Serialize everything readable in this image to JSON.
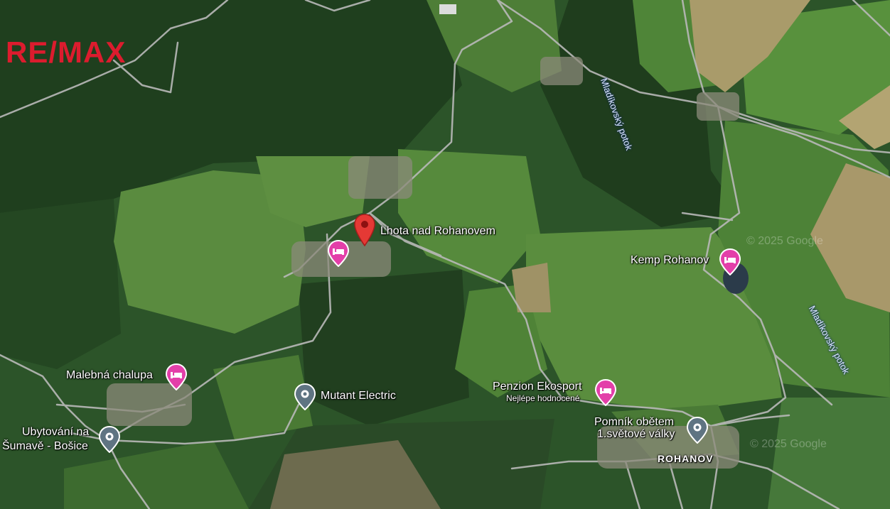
{
  "logo": {
    "text": "RE/MAX"
  },
  "map": {
    "copyright_top": "© 2025 Google",
    "copyright_bottom": "© 2025 Google"
  },
  "places": {
    "main_marker": {
      "label": "Lhota nad Rohanovem",
      "icon": "red-location-pin-icon"
    },
    "kemp": {
      "label": "Kemp Rohanov",
      "icon": "hotel-bed-icon"
    },
    "malebna": {
      "label": "Malebná chalupa",
      "icon": "hotel-bed-icon"
    },
    "penzion": {
      "label": "Penzion Ekosport",
      "sublabel": "Nejlépe hodnocené",
      "icon": "hotel-bed-icon"
    },
    "mutant": {
      "label": "Mutant Electric",
      "icon": "place-pin-icon"
    },
    "ubytovani": {
      "line1": "Ubytování na",
      "line2": "Šumavě - Bošice",
      "icon": "place-pin-icon"
    },
    "pomnik": {
      "line1": "Pomník obětem",
      "line2": "1.světové války",
      "icon": "place-pin-icon"
    },
    "unnamed_hotel": {
      "icon": "hotel-bed-icon"
    }
  },
  "towns": {
    "rohanov": "ROHANOV"
  },
  "streams": {
    "top": "Mladíkovský potok",
    "right": "Mladíkovský potok"
  },
  "colors": {
    "hotel_pin": "#e33fa9",
    "place_pin": "#5f7482",
    "main_pin": "#e53935",
    "remax_red": "#dc1c2e"
  }
}
